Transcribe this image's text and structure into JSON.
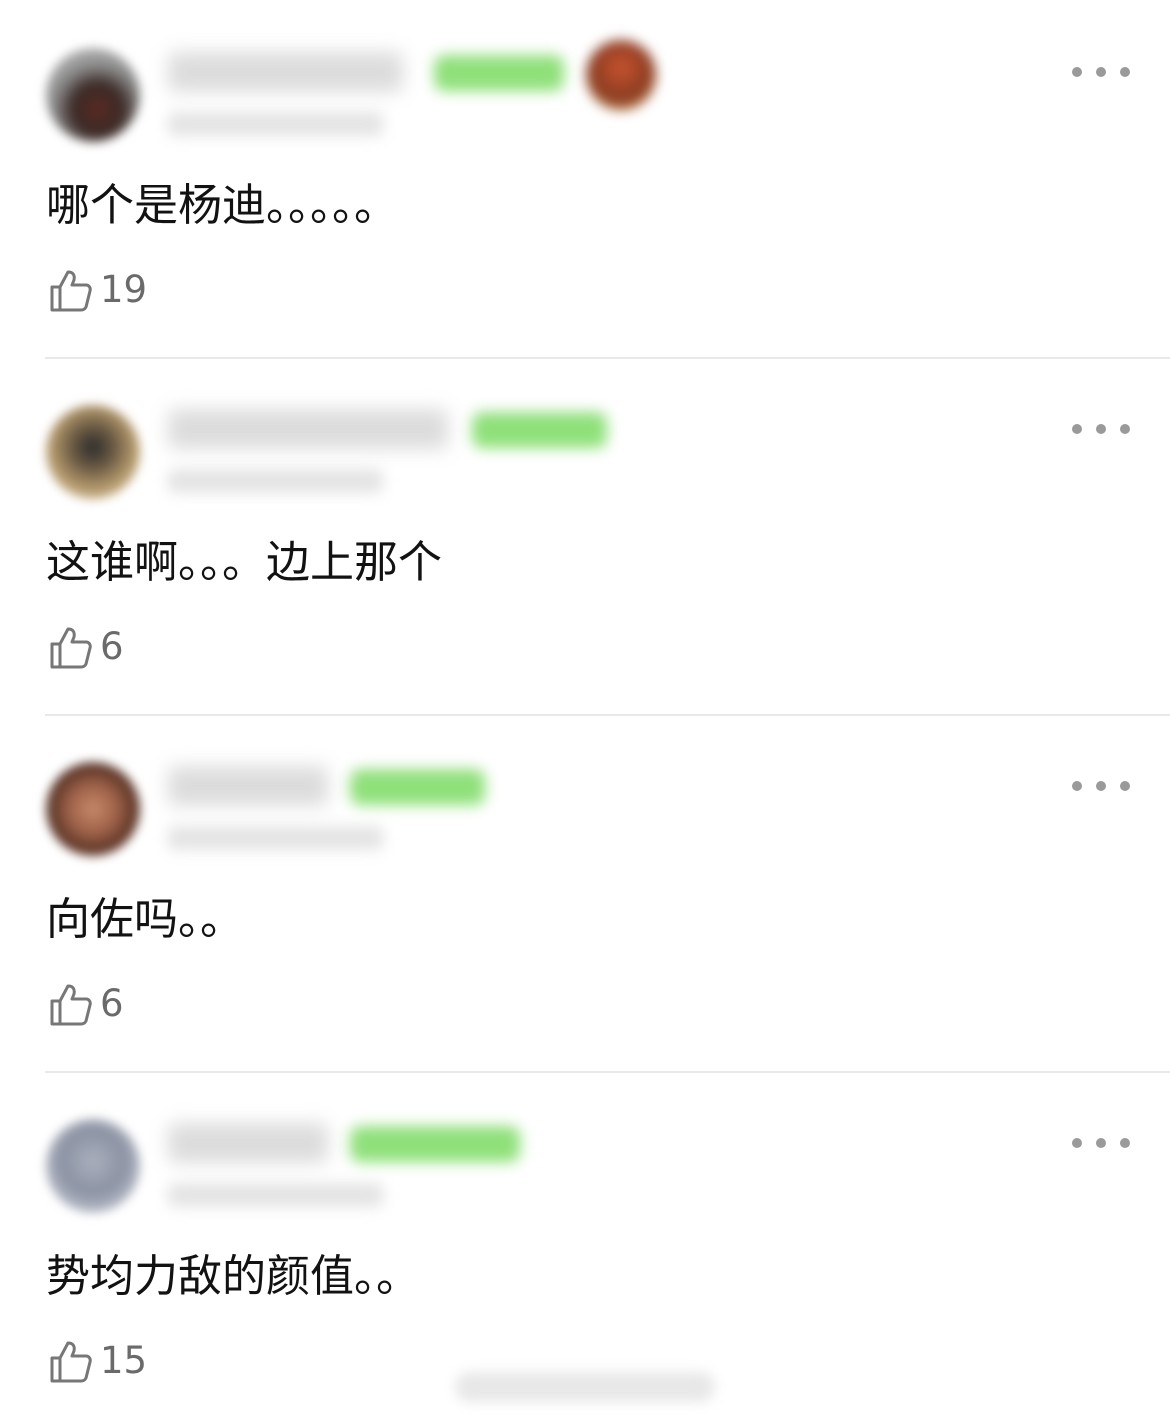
{
  "colors": {
    "background": "#ffffff",
    "comment_text": "#121212",
    "like_icon": "#777777",
    "like_count": "#6a6a6a",
    "more_dots": "#9a9a9a",
    "badge_blur": "#8fe07a",
    "divider": "#e9e9e9"
  },
  "icons": {
    "like": "thumbs-up-icon",
    "more": "more-horizontal-icon"
  },
  "comments": [
    {
      "text": "哪个是杨迪。。。。。",
      "likes": "19"
    },
    {
      "text": "这谁啊。。。边上那个",
      "likes": "6"
    },
    {
      "text": "向佐吗。。",
      "likes": "6"
    },
    {
      "text": "势均力敌的颜值。。",
      "likes": "15"
    }
  ]
}
